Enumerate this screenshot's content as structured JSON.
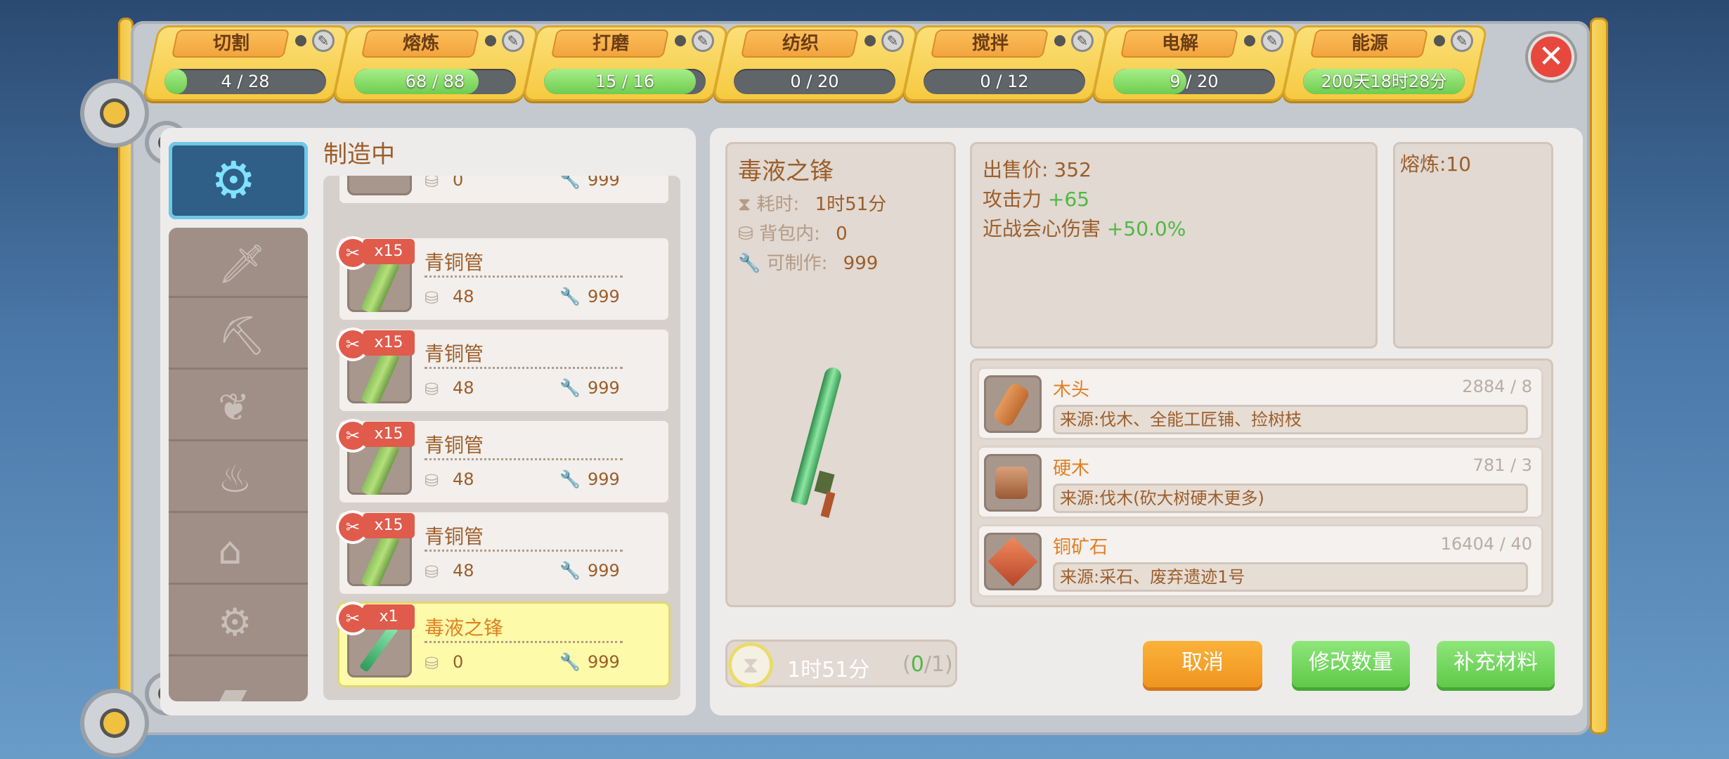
{
  "tabs": [
    {
      "label": "切割",
      "progress_text": "4 / 28",
      "progress": 0.14
    },
    {
      "label": "熔炼",
      "progress_text": "68 / 88",
      "progress": 0.77
    },
    {
      "label": "打磨",
      "progress_text": "15 / 16",
      "progress": 0.94
    },
    {
      "label": "纺织",
      "progress_text": "0 / 20",
      "progress": 0
    },
    {
      "label": "搅拌",
      "progress_text": "0 / 12",
      "progress": 0
    },
    {
      "label": "电解",
      "progress_text": "9 / 20",
      "progress": 0.45
    },
    {
      "label": "能源",
      "progress_text": "200天18时28分",
      "progress": 1.0
    }
  ],
  "section_title": "制造中",
  "queue": [
    {
      "name": "",
      "count": "",
      "bag": "0",
      "craftable": "999",
      "thumb": "ingot",
      "selected": false
    },
    {
      "name": "青铜管",
      "count": "x15",
      "bag": "48",
      "craftable": "999",
      "thumb": "tube",
      "selected": false
    },
    {
      "name": "青铜管",
      "count": "x15",
      "bag": "48",
      "craftable": "999",
      "thumb": "tube",
      "selected": false
    },
    {
      "name": "青铜管",
      "count": "x15",
      "bag": "48",
      "craftable": "999",
      "thumb": "tube",
      "selected": false
    },
    {
      "name": "青铜管",
      "count": "x15",
      "bag": "48",
      "craftable": "999",
      "thumb": "tube",
      "selected": false
    },
    {
      "name": "毒液之锋",
      "count": "x1",
      "bag": "0",
      "craftable": "999",
      "thumb": "sword",
      "selected": true
    }
  ],
  "detail": {
    "name": "毒液之锋",
    "time_label": "耗时:",
    "time_value": "1时51分",
    "bag_label": "背包内:",
    "bag_value": "0",
    "craftable_label": "可制作:",
    "craftable_value": "999"
  },
  "stats": {
    "price_label": "出售价:",
    "price_value": "352",
    "attack_label": "攻击力",
    "attack_value": "+65",
    "crit_label": "近战会心伤害",
    "crit_value": "+50.0%"
  },
  "smelt_label": "熔炼:10",
  "materials": [
    {
      "name": "木头",
      "count": "2884 / 8",
      "source": "来源:伐木、全能工匠铺、捡树枝",
      "icon": "wood-icon"
    },
    {
      "name": "硬木",
      "count": "781 / 3",
      "source": "来源:伐木(砍大树硬木更多)",
      "icon": "hardwood-icon"
    },
    {
      "name": "铜矿石",
      "count": "16404 / 40",
      "source": "来源:采石、废弃遗迹1号",
      "icon": "copper-ore-icon"
    }
  ],
  "timer": {
    "text": "1时51分",
    "count_open": "(",
    "count_done": "0",
    "count_rest": "/1)"
  },
  "buttons": {
    "cancel": "取消",
    "modify": "修改数量",
    "refill": "补充材料"
  },
  "colors": {
    "accent_orange": "#f0951e",
    "accent_green": "#5fc94a",
    "tab_yellow": "#f6c93f",
    "text_brown": "#9c5e2a"
  }
}
